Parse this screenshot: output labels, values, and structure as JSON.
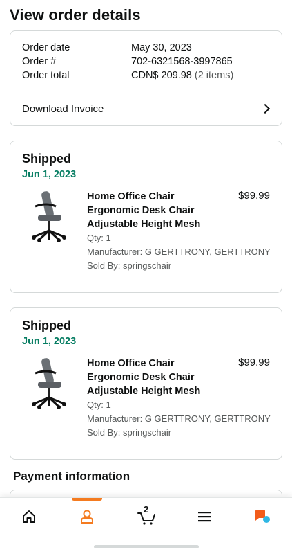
{
  "page": {
    "title": "View order details"
  },
  "summary": {
    "rows": [
      {
        "label": "Order date",
        "value": "May 30, 2023",
        "extra": ""
      },
      {
        "label": "Order #",
        "value": "702-6321568-3997865",
        "extra": ""
      },
      {
        "label": "Order total",
        "value": "CDN$ 209.98",
        "extra": "(2 items)"
      }
    ],
    "invoice_label": "Download Invoice"
  },
  "shipments": [
    {
      "status": "Shipped",
      "date": "Jun 1, 2023",
      "item": {
        "title": "Home Office Chair Ergonomic Desk Chair Adjustable Height Mesh",
        "price": "$99.99",
        "qty": "Qty: 1",
        "manufacturer": "Manufacturer: G GERTTRONY, GERTTRONY",
        "sold_by": "Sold By: springschair"
      }
    },
    {
      "status": "Shipped",
      "date": "Jun 1, 2023",
      "item": {
        "title": "Home Office Chair Ergonomic Desk Chair Adjustable Height Mesh",
        "price": "$99.99",
        "qty": "Qty: 1",
        "manufacturer": "Manufacturer: G GERTTRONY, GERTTRONY",
        "sold_by": "Sold By: springschair"
      }
    }
  ],
  "payment": {
    "title": "Payment information"
  },
  "bottom_nav": {
    "items": [
      {
        "name": "home",
        "icon": "home-icon"
      },
      {
        "name": "account",
        "icon": "person-icon",
        "active": true
      },
      {
        "name": "cart",
        "icon": "cart-icon",
        "count": "2"
      },
      {
        "name": "menu",
        "icon": "hamburger-icon"
      },
      {
        "name": "rufus",
        "icon": "chat-bubble-icon"
      }
    ]
  },
  "colors": {
    "accent": "#f47b20",
    "ship_date": "#067d62",
    "text": "#0f1111",
    "muted": "#565959",
    "border": "#d5d9d9",
    "assistant_blue": "#2fb7e4"
  }
}
